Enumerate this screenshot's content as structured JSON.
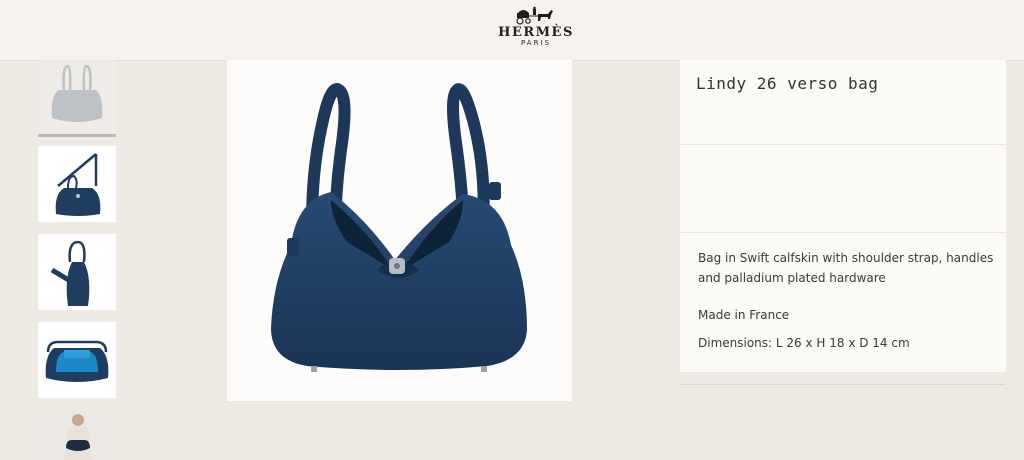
{
  "brand": {
    "name": "HERMÈS",
    "city": "PARIS"
  },
  "product": {
    "title": "Lindy 26 verso bag",
    "description": "Bag in Swift calfskin with shoulder strap, handles and palladium plated hardware",
    "origin": "Made in France",
    "dimensions": "Dimensions: L 26 x H 18 x D 14 cm"
  },
  "gallery": {
    "thumbnails": [
      {
        "view": "front-selected"
      },
      {
        "view": "shoulder-strap"
      },
      {
        "view": "standing-side"
      },
      {
        "view": "open-interior-blue"
      },
      {
        "view": "worn-by-model"
      }
    ]
  },
  "colors": {
    "bag_navy": "#1f3c61",
    "interior_blue": "#1d87c7",
    "page_bg": "#ede9e3"
  }
}
